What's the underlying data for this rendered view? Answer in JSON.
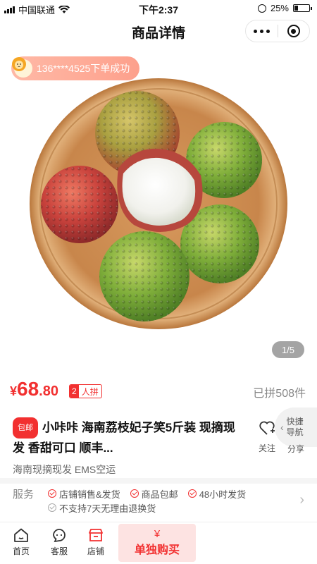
{
  "status_bar": {
    "carrier": "中国联通",
    "time": "下午2:37",
    "battery_text": "25%",
    "battery_level": 0.25
  },
  "nav": {
    "title": "商品详情"
  },
  "gallery": {
    "toast": "136****4525下单成功",
    "pager": "1/5"
  },
  "price": {
    "currency": "¥",
    "integer": "68",
    "decimal": ".80",
    "group_count": "2",
    "group_text": "人拼",
    "sold": "已拼508件"
  },
  "product": {
    "tag": "包邮",
    "title": "小咔咔 海南荔枝妃子笑5斤装 现摘现发 香甜可口 顺丰...",
    "subtitle": "海南现摘现发 EMS空运"
  },
  "actions": {
    "follow": "关注",
    "share": "分享",
    "quick_nav": "快捷导航"
  },
  "service": {
    "label": "服务",
    "items": [
      "店铺销售&发货",
      "商品包邮",
      "48小时发货"
    ],
    "note": "不支持7天无理由退换货"
  },
  "bottom": {
    "home": "首页",
    "support": "客服",
    "store": "店铺",
    "buy_symbol": "¥",
    "buy_label": "单独购买"
  },
  "colors": {
    "accent": "#f23030",
    "toast": "#fda08c"
  }
}
